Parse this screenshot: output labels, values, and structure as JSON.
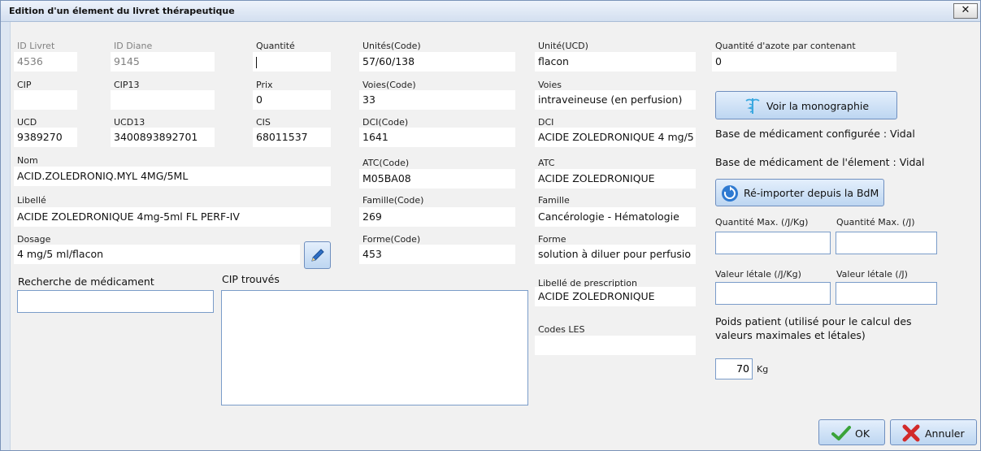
{
  "dialog": {
    "title": "Edition d'un élement du livret thérapeutique",
    "close_label": "✕"
  },
  "fields": {
    "id_livret": {
      "label": "ID Livret",
      "value": "4536"
    },
    "id_diane": {
      "label": "ID Diane",
      "value": "9145"
    },
    "quantite": {
      "label": "Quantité",
      "value": ""
    },
    "unites_code": {
      "label": "Unités(Code)",
      "value": "57/60/138"
    },
    "unite_ucd": {
      "label": "Unité(UCD)",
      "value": "flacon"
    },
    "azote": {
      "label": "Quantité d'azote par contenant",
      "value": "0"
    },
    "cip": {
      "label": "CIP",
      "value": ""
    },
    "cip13": {
      "label": "CIP13",
      "value": ""
    },
    "prix": {
      "label": "Prix",
      "value": "0"
    },
    "voies_code": {
      "label": "Voies(Code)",
      "value": "33"
    },
    "voies": {
      "label": "Voies",
      "value": "intraveineuse (en perfusion)"
    },
    "ucd": {
      "label": "UCD",
      "value": "9389270"
    },
    "ucd13": {
      "label": "UCD13",
      "value": "3400893892701"
    },
    "cis": {
      "label": "CIS",
      "value": "68011537"
    },
    "dci_code": {
      "label": "DCI(Code)",
      "value": "1641"
    },
    "dci": {
      "label": "DCI",
      "value": "ACIDE ZOLEDRONIQUE 4 mg/5"
    },
    "nom": {
      "label": "Nom",
      "value": "ACID.ZOLEDRONIQ.MYL 4MG/5ML"
    },
    "atc_code": {
      "label": "ATC(Code)",
      "value": "M05BA08"
    },
    "atc": {
      "label": "ATC",
      "value": "ACIDE ZOLEDRONIQUE"
    },
    "libelle": {
      "label": "Libellé",
      "value": "ACIDE ZOLEDRONIQUE 4mg-5ml FL PERF-IV"
    },
    "famille_code": {
      "label": "Famille(Code)",
      "value": "269"
    },
    "famille": {
      "label": "Famille",
      "value": "Cancérologie - Hématologie"
    },
    "dosage": {
      "label": "Dosage",
      "value": "4 mg/5 ml/flacon"
    },
    "forme_code": {
      "label": "Forme(Code)",
      "value": "453"
    },
    "forme": {
      "label": "Forme",
      "value": "solution à diluer pour perfusio"
    },
    "libelle_prescription": {
      "label": "Libellé de prescription",
      "value": "ACIDE ZOLEDRONIQUE"
    },
    "codes_les": {
      "label": "Codes LES",
      "value": ""
    }
  },
  "search": {
    "label": "Recherche de médicament",
    "value": ""
  },
  "cip_trouves": {
    "label": "CIP trouvés"
  },
  "right_panel": {
    "monograph_button": "Voir la monographie",
    "base_configuree": "Base de médicament configurée : Vidal",
    "base_element": "Base de médicament de l'élement : Vidal",
    "reimport_button": "Ré-importer depuis la BdM",
    "qmax_jkg_label": "Quantité Max. (/J/Kg)",
    "qmax_j_label": "Quantité Max. (/J)",
    "vl_jkg_label": "Valeur létale (/J/Kg)",
    "vl_j_label": "Valeur létale (/J)",
    "poids_label": "Poids patient (utilisé pour le calcul des valeurs maximales et létales)",
    "poids_value": "70",
    "poids_unit": "Kg"
  },
  "footer": {
    "ok_label": "OK",
    "cancel_label": "Annuler"
  },
  "icons": {
    "monograph": "caduceus-icon",
    "reimport": "refresh-icon",
    "edit": "pencil-icon",
    "ok": "check-icon",
    "cancel": "cross-icon"
  },
  "colors": {
    "accent": "#2f7ad1",
    "ok": "#3aa33a",
    "cancel": "#d22a2a"
  }
}
